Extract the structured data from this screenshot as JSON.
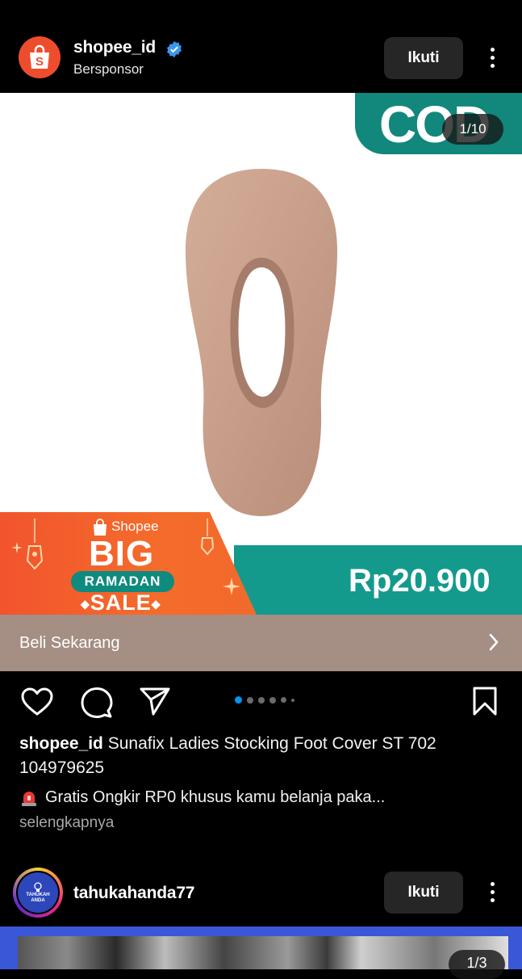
{
  "post1": {
    "username": "shopee_id",
    "subtitle": "Bersponsor",
    "follow_label": "Ikuti",
    "ad": {
      "cod_text": "COD",
      "page_counter": "1/10",
      "promo_brand": "Shopee",
      "promo_big": "BIG",
      "promo_ramadan": "RAMADAN",
      "promo_sale": "SALE",
      "price": "Rp20.900"
    },
    "cta_label": "Beli Sekarang",
    "carousel": {
      "count": 6,
      "active_index": 0
    },
    "caption_username": "shopee_id",
    "caption_text": "Sunafix Ladies Stocking Foot Cover ST 702 104979625",
    "promo_line": "Gratis Ongkir RP0 khusus kamu belanja paka...",
    "more_link": "selengkapnya"
  },
  "post2": {
    "username": "tahukahanda77",
    "avatar_text_line1": "TAHUKAH",
    "avatar_text_line2": "ANDA",
    "follow_label": "Ikuti",
    "page_counter": "1/3"
  },
  "colors": {
    "shopee_orange": "#ee4d2d",
    "teal": "#149a8d",
    "cta_bar": "#a58e84",
    "verified_blue": "#3897f0",
    "active_dot": "#0095f6"
  }
}
